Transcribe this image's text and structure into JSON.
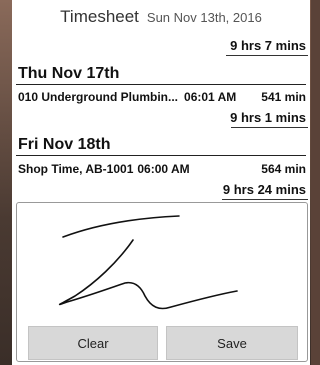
{
  "header": {
    "title": "Timesheet",
    "date": "Sun Nov 13th, 2016"
  },
  "days": [
    {
      "heading": "",
      "entries": [],
      "total": "9 hrs 7 mins"
    },
    {
      "heading": "Thu Nov 17th",
      "entries": [
        {
          "job": "010 Underground Plumbin...",
          "time": "06:01 AM",
          "minutes": "541 min"
        }
      ],
      "total": "9 hrs 1 mins"
    },
    {
      "heading": "Fri Nov 18th",
      "entries": [
        {
          "job": "Shop Time, AB-1001",
          "time": "06:00 AM",
          "minutes": "564 min"
        }
      ],
      "total": "9 hrs 24 mins"
    }
  ],
  "signature": {
    "clear_label": "Clear",
    "save_label": "Save"
  }
}
